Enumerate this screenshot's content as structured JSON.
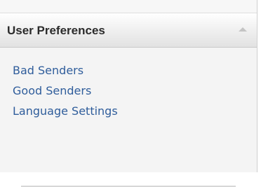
{
  "panel": {
    "title": "User Preferences",
    "collapse_icon": "chevron-up-icon",
    "links": [
      {
        "label": "Bad Senders"
      },
      {
        "label": "Good Senders"
      },
      {
        "label": "Language Settings"
      }
    ]
  },
  "colors": {
    "link": "#2f5d9b",
    "header_text": "#2b2b2b",
    "panel_background": "#f4f4f4"
  }
}
